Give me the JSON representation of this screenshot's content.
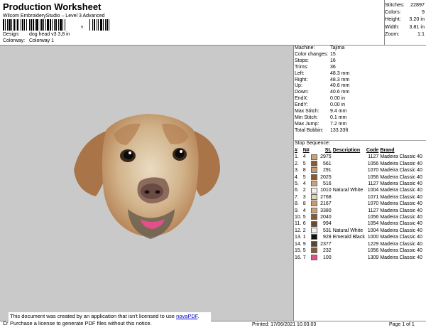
{
  "header": {
    "title": "Production Worksheet",
    "subtitle": "Wilcom EmbroideryStudio – Level 3 Advanced",
    "design_label": "Design:",
    "design_value": "dog head v3 3,8 in",
    "colorway_label": "Colorway:",
    "colorway_value": "Colorway 1"
  },
  "summary": [
    {
      "label": "Stitches:",
      "value": "22897"
    },
    {
      "label": "Colors:",
      "value": "9"
    },
    {
      "label": "Height:",
      "value": "3.20 in"
    },
    {
      "label": "Width:",
      "value": "3.81 in"
    },
    {
      "label": "Zoom:",
      "value": "1:1"
    }
  ],
  "params": [
    {
      "label": "Machine:",
      "value": "Tajima"
    },
    {
      "label": "Color changes:",
      "value": "15"
    },
    {
      "label": "Stops:",
      "value": "16"
    },
    {
      "label": "Trims:",
      "value": "36"
    },
    {
      "label": "Left:",
      "value": "48.3 mm"
    },
    {
      "label": "Right:",
      "value": "48.3 mm"
    },
    {
      "label": "Up:",
      "value": "40.6 mm"
    },
    {
      "label": "Down:",
      "value": "40.6 mm"
    },
    {
      "label": "EndX:",
      "value": "0.00 in"
    },
    {
      "label": "EndY:",
      "value": "0.00 in"
    },
    {
      "label": "Max Stitch:",
      "value": "9.4 mm"
    },
    {
      "label": "Min Stitch:",
      "value": "0.1 mm"
    },
    {
      "label": "Max Jump:",
      "value": "7.2 mm"
    },
    {
      "label": "Total Bobbin:",
      "value": "133.33ft"
    }
  ],
  "sequence": {
    "title": "Stop Sequence:",
    "headers": [
      "#",
      "N#",
      "St.",
      "Description",
      "Code",
      "Brand"
    ],
    "rows": [
      {
        "n": "1.",
        "nn": "4",
        "color": "#c9a27a",
        "st": "2975",
        "desc": "",
        "code": "1127",
        "brand": "Madeira Classic 40"
      },
      {
        "n": "2.",
        "nn": "5",
        "color": "#8a5a33",
        "st": "561",
        "desc": "",
        "code": "1056",
        "brand": "Madeira Classic 40"
      },
      {
        "n": "3.",
        "nn": "8",
        "color": "#cf9a68",
        "st": "291",
        "desc": "",
        "code": "1070",
        "brand": "Madeira Classic 40"
      },
      {
        "n": "4.",
        "nn": "5",
        "color": "#8a5a33",
        "st": "2025",
        "desc": "",
        "code": "1056",
        "brand": "Madeira Classic 40"
      },
      {
        "n": "5.",
        "nn": "4",
        "color": "#c9a27a",
        "st": "516",
        "desc": "",
        "code": "1127",
        "brand": "Madeira Classic 40"
      },
      {
        "n": "6.",
        "nn": "2",
        "color": "#f3f0ea",
        "st": "1010",
        "desc": "Natural White",
        "code": "1004",
        "brand": "Madeira Classic 40"
      },
      {
        "n": "7.",
        "nn": "3",
        "color": "#e0d3b8",
        "st": "2768",
        "desc": "",
        "code": "1071",
        "brand": "Madeira Classic 40"
      },
      {
        "n": "8.",
        "nn": "8",
        "color": "#cf9a68",
        "st": "2167",
        "desc": "",
        "code": "1070",
        "brand": "Madeira Classic 40"
      },
      {
        "n": "9.",
        "nn": "4",
        "color": "#c9a27a",
        "st": "3380",
        "desc": "",
        "code": "1127",
        "brand": "Madeira Classic 40"
      },
      {
        "n": "10.",
        "nn": "5",
        "color": "#8a5a33",
        "st": "2040",
        "desc": "",
        "code": "1056",
        "brand": "Madeira Classic 40"
      },
      {
        "n": "11.",
        "nn": "6",
        "color": "#6e4a2c",
        "st": "994",
        "desc": "",
        "code": "1054",
        "brand": "Madeira Classic 40"
      },
      {
        "n": "12.",
        "nn": "2",
        "color": "#f3f0ea",
        "st": "531",
        "desc": "Natural White",
        "code": "1004",
        "brand": "Madeira Classic 40"
      },
      {
        "n": "13.",
        "nn": "1",
        "color": "#111111",
        "st": "928",
        "desc": "Emerald Black",
        "code": "1000",
        "brand": "Madeira Classic 40"
      },
      {
        "n": "14.",
        "nn": "9",
        "color": "#5a4632",
        "st": "2377",
        "desc": "",
        "code": "1229",
        "brand": "Madeira Classic 40"
      },
      {
        "n": "15.",
        "nn": "5",
        "color": "#8a5a33",
        "st": "232",
        "desc": "",
        "code": "1056",
        "brand": "Madeira Classic 40"
      },
      {
        "n": "16.",
        "nn": "7",
        "color": "#e0508a",
        "st": "100",
        "desc": "",
        "code": "1309",
        "brand": "Madeira Classic 40"
      }
    ]
  },
  "footer": {
    "notice_line1": "This document was created by an application that isn't licensed to use ",
    "notice_link": "novaPDF",
    "notice_line1_end": ".",
    "notice_line2": "Purchase a license to generate PDF files without this notice.",
    "cr": "Cr",
    "printed": "Printed: 17/06/2021 10.03.03",
    "page": "Page 1 of 1"
  }
}
